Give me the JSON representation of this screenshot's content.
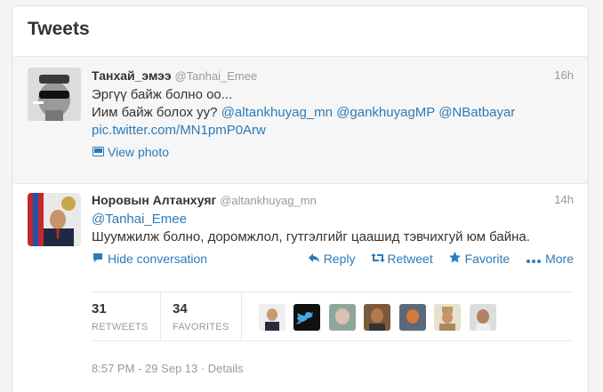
{
  "header": {
    "title": "Tweets"
  },
  "tweets": [
    {
      "fullname": "Танхай_эмээ",
      "username": "@Tanhai_Emee",
      "time": "16h",
      "line1": "Эргүү байж болно оо...",
      "line2_prefix": "Иим байж болох уу? ",
      "mentions": [
        "@altankhuyag_mn",
        "@gankhuyagMP",
        "@NBatbayar"
      ],
      "pic_link": "pic.twitter.com/MN1pmP0Arw",
      "view_photo": "View photo"
    },
    {
      "fullname": "Норовын Алтанхуяг",
      "username": "@altankhuyag_mn",
      "time": "14h",
      "reply_to": "@Tanhai_Emee",
      "text": "Шуумжилж болно, доромжлол, гутгэлгийг цаашид тэвчихгуй юм байна.",
      "hide_conversation": "Hide conversation",
      "actions": {
        "reply": "Reply",
        "retweet": "Retweet",
        "favorite": "Favorite",
        "more": "More"
      },
      "stats": {
        "retweets_count": "31",
        "retweets_label": "RETWEETS",
        "favorites_count": "34",
        "favorites_label": "FAVORITES"
      },
      "meta": "8:57 PM - 29 Sep 13 · Details"
    }
  ]
}
